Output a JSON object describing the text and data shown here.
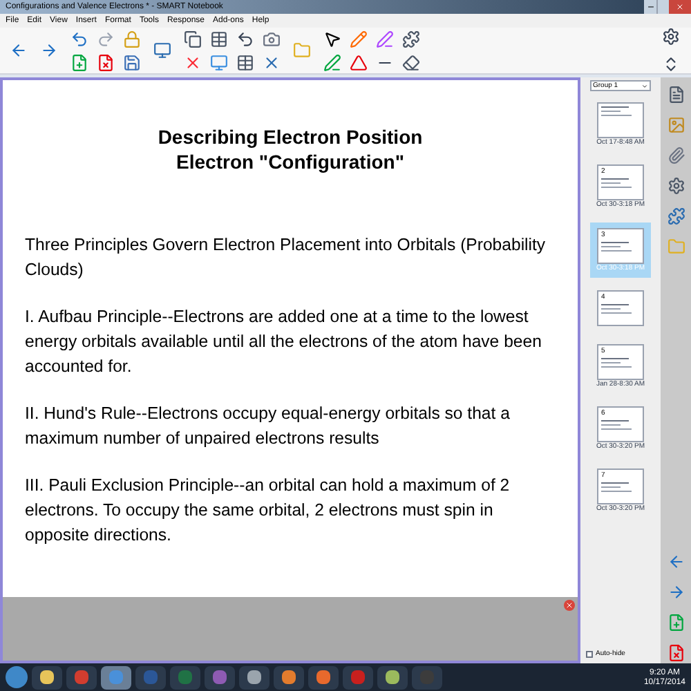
{
  "window": {
    "title": "Configurations and Valence Electrons * - SMART Notebook"
  },
  "menu": [
    "File",
    "Edit",
    "View",
    "Insert",
    "Format",
    "Tools",
    "Response",
    "Add-ons",
    "Help"
  ],
  "page": {
    "heading": [
      "Describing Electron Position",
      "Electron \"Configuration\""
    ],
    "paragraphs": [
      "Three Principles Govern Electron Placement into Orbitals (Probability Clouds)",
      "I.  Aufbau Principle--Electrons are added one at a time to the lowest energy orbitals available until all the electrons of the atom have been accounted for.",
      "II.  Hund's Rule--Electrons occupy equal-energy orbitals so that a maximum number of unpaired electrons results",
      "III.  Pauli Exclusion Principle--an orbital can hold a maximum of 2 electrons.  To occupy the same orbital, 2 electrons must spin in opposite directions."
    ]
  },
  "sorter": {
    "group": "Group 1",
    "auto_hide": {
      "label": "Auto-hide",
      "checked": false
    },
    "pages": [
      {
        "label": "Oct 17-8:48 AM",
        "selected": false
      },
      {
        "number": "2",
        "label": "Oct 30-3:18 PM",
        "selected": false
      },
      {
        "number": "3",
        "label": "Oct 30-3:18 PM",
        "selected": true
      },
      {
        "number": "4",
        "selected": false
      },
      {
        "number": "5",
        "label": "Jan 28-8:30 AM",
        "selected": false
      },
      {
        "number": "6",
        "label": "Oct 30-3:20 PM",
        "selected": false
      },
      {
        "number": "7",
        "label": "Oct 30-3:20 PM",
        "selected": false
      }
    ]
  },
  "taskbar": {
    "time": "9:20 AM",
    "date": "10/17/2014"
  }
}
